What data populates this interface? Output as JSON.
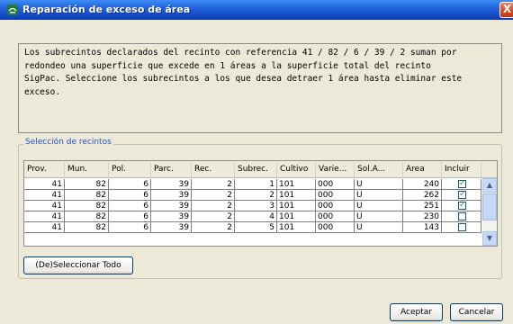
{
  "window": {
    "title": "Reparación de exceso de área",
    "close_label": "X"
  },
  "message": "Los subrecintos declarados del recinto con referencia 41 / 82 / 6 / 39 / 2 suman por\nredondeo una superficie que excede en 1 áreas a la superficie total del recinto\nSigPac. Seleccione los subrecintos a los que desea detraer 1 área hasta eliminar este\nexceso.",
  "group": {
    "legend": "Selección de recintos"
  },
  "table": {
    "columns": [
      "Prov.",
      "Mun.",
      "Pol.",
      "Parc.",
      "Rec.",
      "Subrec.",
      "Cultivo",
      "Varie...",
      "Sol.A...",
      "Area",
      "Incluir"
    ],
    "rows": [
      {
        "prov": "41",
        "mun": "82",
        "pol": "6",
        "parc": "39",
        "rec": "2",
        "subrec": "1",
        "cultivo": "101",
        "variedad": "000",
        "sol": "U",
        "area": "240",
        "incluir": true
      },
      {
        "prov": "41",
        "mun": "82",
        "pol": "6",
        "parc": "39",
        "rec": "2",
        "subrec": "2",
        "cultivo": "101",
        "variedad": "000",
        "sol": "U",
        "area": "262",
        "incluir": true
      },
      {
        "prov": "41",
        "mun": "82",
        "pol": "6",
        "parc": "39",
        "rec": "2",
        "subrec": "3",
        "cultivo": "101",
        "variedad": "000",
        "sol": "U",
        "area": "251",
        "incluir": true
      },
      {
        "prov": "41",
        "mun": "82",
        "pol": "6",
        "parc": "39",
        "rec": "2",
        "subrec": "4",
        "cultivo": "101",
        "variedad": "000",
        "sol": "U",
        "area": "230",
        "incluir": false
      },
      {
        "prov": "41",
        "mun": "82",
        "pol": "6",
        "parc": "39",
        "rec": "2",
        "subrec": "5",
        "cultivo": "101",
        "variedad": "000",
        "sol": "U",
        "area": "143",
        "incluir": false
      }
    ]
  },
  "buttons": {
    "select_all": "(De)Seleccionar Todo",
    "accept": "Aceptar",
    "cancel": "Cancelar"
  },
  "icons": {
    "title": "app-icon",
    "scroll_up": "chevron-up-icon",
    "scroll_down": "chevron-down-icon"
  },
  "colors": {
    "titlebar": "#1f5fd8",
    "legend": "#2355c4",
    "check": "#21a121",
    "close": "#d44623"
  }
}
